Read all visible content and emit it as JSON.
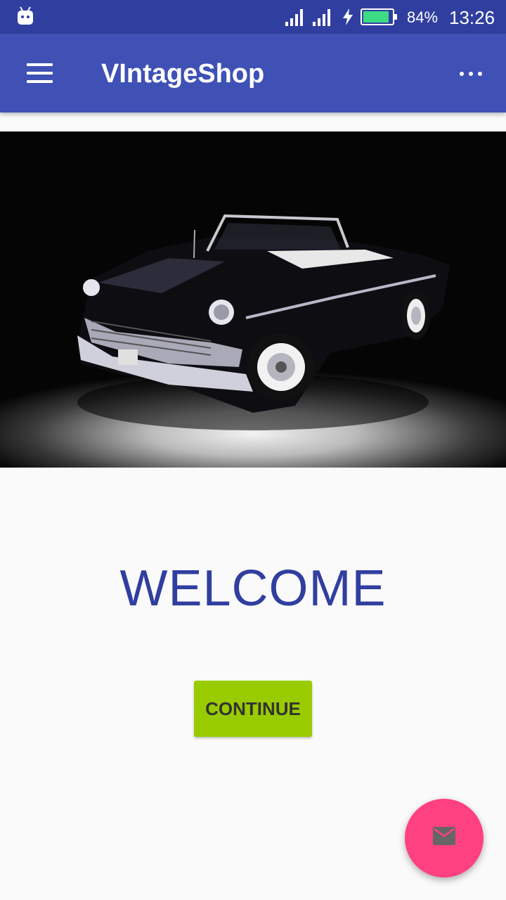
{
  "status_bar": {
    "battery_percent": "84%",
    "time": "13:26",
    "icons": [
      "android-notification-icon",
      "signal-icon",
      "signal-icon",
      "charging-icon",
      "battery-icon"
    ]
  },
  "app_bar": {
    "title": "VIntageShop",
    "icons": [
      "menu-icon",
      "more-vert-icon"
    ],
    "color": "#3f51b5"
  },
  "main": {
    "welcome_text": "WELCOME",
    "continue_label": "CONTINUE"
  },
  "fab": {
    "icon": "mail-icon",
    "color": "#ff4081"
  },
  "colors": {
    "status_bar": "#303f9f",
    "accent_green": "#99cc00",
    "welcome_text": "#303f9f"
  }
}
